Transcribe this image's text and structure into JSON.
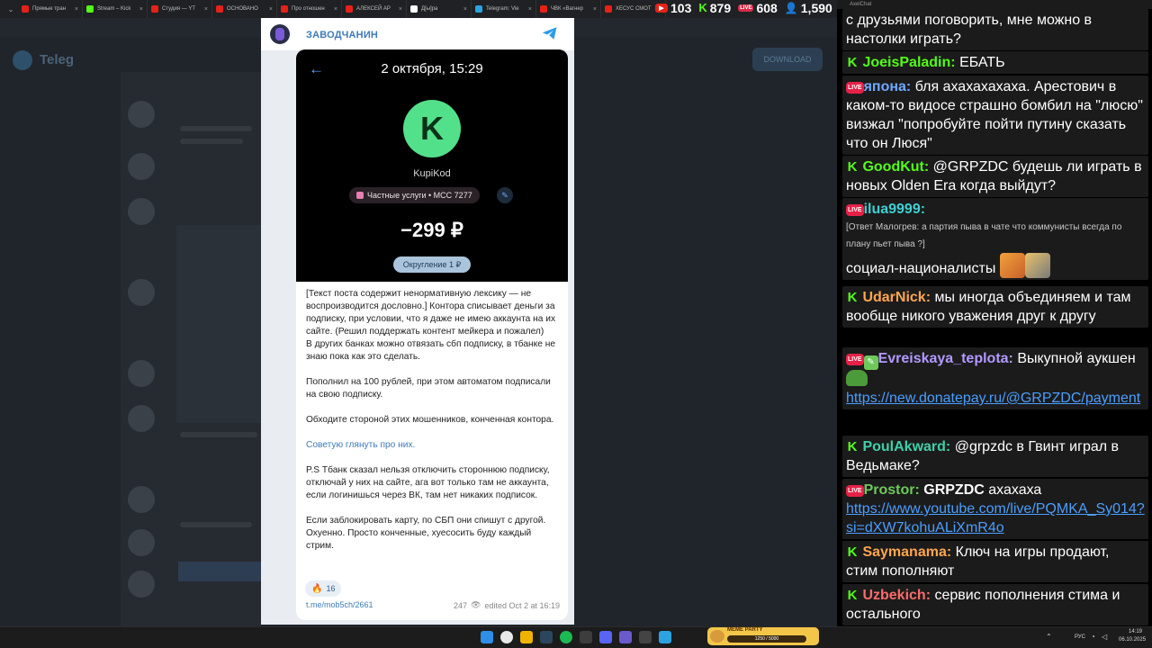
{
  "browser": {
    "tabs": [
      {
        "label": "Прямые тран",
        "color": "#e62117"
      },
      {
        "label": "Stream – Kick",
        "color": "#53fc18"
      },
      {
        "label": "Студия — YT",
        "color": "#e62117"
      },
      {
        "label": "ОСНОВАНО",
        "color": "#e62117"
      },
      {
        "label": "Про отношен",
        "color": "#e62117"
      },
      {
        "label": "АЛЕКСЕЙ АР",
        "color": "#e62117"
      },
      {
        "label": "Д[ы]ра",
        "color": "#ffffff"
      },
      {
        "label": "Telegram: Vie",
        "color": "#2aa3e0"
      },
      {
        "label": "ЧВК «Вагнер",
        "color": "#e62117"
      },
      {
        "label": "ХЕСУС СМОТ",
        "color": "#e62117"
      }
    ]
  },
  "stats": {
    "youtube_viewers": "103",
    "kick_viewers": "879",
    "live_viewers": "608",
    "total_viewers": "1,590"
  },
  "background_app": {
    "title": "Teleg",
    "download_button": "DOWNLOAD"
  },
  "post": {
    "channel_name": "ЗАВОДЧАНИН",
    "receipt": {
      "date": "2 октября, 15:29",
      "merchant_initial": "K",
      "merchant": "KupiKod",
      "category": "Частные услуги • MCC 7277",
      "amount": "−299 ₽",
      "rounding": "Округление 1 ₽"
    },
    "paragraphs": [
      "[Текст поста содержит ненормативную лексику — не воспроизводится дословно.] Контора списывает деньги за подписку, при условии, что я даже не имею аккаунта на их сайте. (Решил поддержать контент мейкера и пожалел)\nВ других банках можно отвязать сбп подписку, в тбанке не знаю пока как это сделать.",
      "Пополнил на 100 рублей, при этом автоматом подписали на свою подписку.",
      "Обходите стороной этих мошенников, конченная контора.",
      "P.S Тбанк сказал нельзя отключить стороннюю подписку, отключай у них на сайте, ага вот только там не аккаунта, если логинишься через ВК, там нет никаких подписок.",
      "Если заблокировать карту, по СБП они спишут с другой. Охуенно. Просто конченные, хуесосить буду каждый стрим."
    ],
    "link_line": "Советую глянуть про них.",
    "reaction_count": "16",
    "link": "t.me/mob5ch/2661",
    "views": "247",
    "edited": "edited  Oct 2 at 16:19"
  },
  "chat": {
    "header": "AxelChat",
    "messages": [
      {
        "platform": "none",
        "nick": "",
        "color": "#ffffff",
        "text": "с друзьями поговорить, мне можно в настолки играть?"
      },
      {
        "platform": "kick",
        "nick": "JoeisPaladin:",
        "color": "#53fc18",
        "text": "ЕБАТЬ"
      },
      {
        "platform": "live",
        "nick": "япона:",
        "color": "#6fa9ff",
        "text": "бля ахахахахаха. Арестович в каком-то видосе страшно бомбил на \"люсю\" визжал \"попробуйте пойти путину сказать что он Люся\""
      },
      {
        "platform": "kick",
        "nick": "GoodKut:",
        "color": "#53fc18",
        "text": "@GRPZDC будешь ли играть в новых Olden Era когда выйдут?"
      },
      {
        "platform": "live",
        "nick": "ilua9999:",
        "color": "#3fd0d4",
        "reply": "[Ответ Малогрев: а партия пыва в чате что коммунисты всегда по плану пьет пыва ?]",
        "text": "социал-националисты"
      },
      {
        "platform": "kick",
        "nick": "UdarNick:",
        "color": "#ffa64d",
        "text": "мы иногда объединяем и там вообще никого уважения друг к другу"
      },
      {
        "platform": "live",
        "nick": "Evreiskaya_teplota:",
        "color": "#b399ff",
        "text": "Выкупной аукшен",
        "link": "https://new.donatepay.ru/@GRPZDC/payment"
      },
      {
        "platform": "kick",
        "nick": "PoulAkward:",
        "color": "#3fd0a8",
        "text": "@grpzdc в Гвинт играл в Ведьмаке?"
      },
      {
        "platform": "live",
        "nick": "Prostor:",
        "color": "#6ec95a",
        "bold_text": "GRPZDC",
        "text": "ахахаха",
        "link": "https://www.youtube.com/live/PQMKA_Sy014?si=dXW7kohuALiXmR4o"
      },
      {
        "platform": "kick",
        "nick": "Saymanama:",
        "color": "#ffa64d",
        "text": "Ключ на игры продают, стим пополняют"
      },
      {
        "platform": "kick",
        "nick": "Uzbekich:",
        "color": "#ff6b6b",
        "text": "сервис пополнения стима и остального"
      }
    ]
  },
  "taskbar": {
    "meme_label": "MEME PARTY",
    "meme_progress": "1250 / 5000",
    "lang": "РУС",
    "time": "14:19",
    "date": "06.10.2025"
  }
}
